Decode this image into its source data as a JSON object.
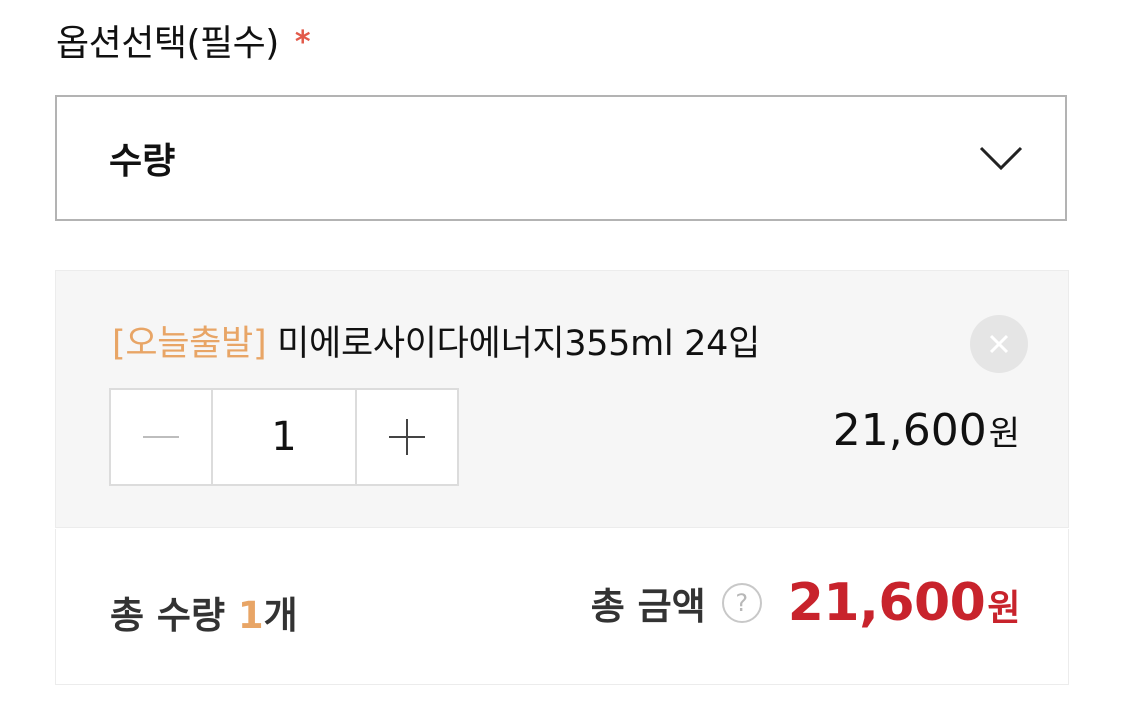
{
  "option_section": {
    "title": "옵션선택(필수)",
    "required_mark": "*"
  },
  "select": {
    "value": "수량",
    "icon": "chevron-down-icon"
  },
  "selected_option": {
    "tag": "[오늘출발]",
    "name": " 미에로사이다에너지355ml 24입",
    "quantity": "1",
    "decrement_symbol": "−",
    "increment_symbol": "+",
    "price": "21,600",
    "currency": "원",
    "remove_icon": "close-icon"
  },
  "total": {
    "qty_prefix": "총 수량 ",
    "qty_value": "1",
    "qty_unit": "개",
    "amount_label": "총 금액",
    "help_symbol": "?",
    "amount": "21,600",
    "currency": "원"
  },
  "colors": {
    "accent_orange": "#e8a566",
    "price_red": "#c8232c",
    "required_red": "#e25a4a"
  }
}
